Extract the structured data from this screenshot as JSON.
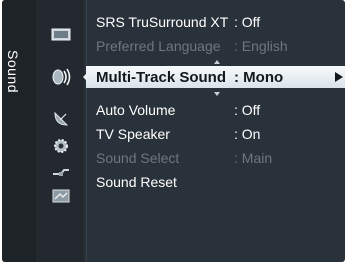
{
  "side_tab": {
    "label": "Sound"
  },
  "icons": [
    "tv-picture-icon",
    "speaker-sound-icon",
    "satellite-dish-icon",
    "gear-icon",
    "plug-input-icon",
    "application-icon"
  ],
  "menu": {
    "items": [
      {
        "label": "SRS TruSurround XT",
        "value": ": Off",
        "disabled": false
      },
      {
        "label": "Preferred Language",
        "value": ": English",
        "disabled": true
      },
      {
        "label": "Multi-Track Sound",
        "value": ": Mono",
        "selected": true
      },
      {
        "label": "Auto Volume",
        "value": ": Off",
        "disabled": false
      },
      {
        "label": "TV Speaker",
        "value": ": On",
        "disabled": false
      },
      {
        "label": "Sound Select",
        "value": ": Main",
        "disabled": true
      },
      {
        "label": "Sound Reset",
        "value": "",
        "disabled": false
      }
    ]
  },
  "colors": {
    "background": "#29323a",
    "highlight": "#e6edf2",
    "disabled_text": "#6e767e"
  }
}
